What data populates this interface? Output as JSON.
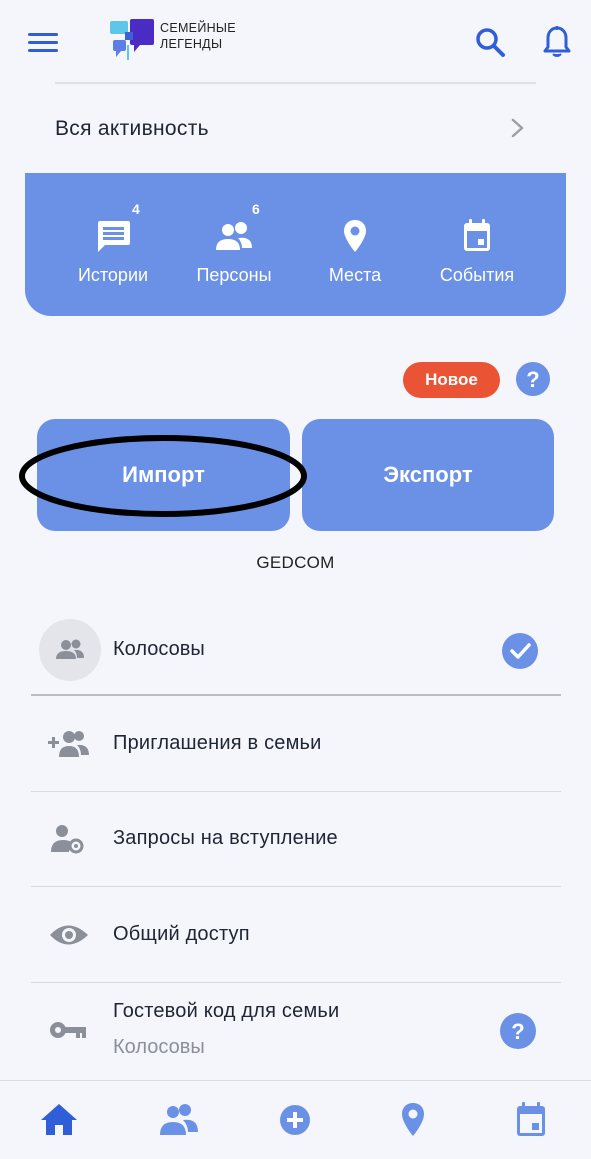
{
  "header": {
    "logo_text_line1": "СЕМЕЙНЫЕ",
    "logo_text_line2": "ЛЕГЕНДЫ",
    "menu_icon": "hamburger-icon",
    "search_icon": "search-icon",
    "notifications_icon": "bell-icon"
  },
  "activity": {
    "label": "Вся активность"
  },
  "stats": [
    {
      "label": "Истории",
      "count": "4",
      "icon": "message-icon"
    },
    {
      "label": "Персоны",
      "count": "6",
      "icon": "people-icon"
    },
    {
      "label": "Места",
      "count": "",
      "icon": "map-pin-icon"
    },
    {
      "label": "События",
      "count": "",
      "icon": "calendar-icon"
    }
  ],
  "badge": {
    "new_label": "Новое"
  },
  "gedcom": {
    "import_label": "Импорт",
    "export_label": "Экспорт",
    "caption": "GEDCOM"
  },
  "family": {
    "name": "Колосовы",
    "selected": true
  },
  "menu": [
    {
      "label": "Приглашения в семьи",
      "icon": "add-group-icon"
    },
    {
      "label": "Запросы на вступление",
      "icon": "user-gear-icon"
    },
    {
      "label": "Общий доступ",
      "icon": "eye-icon"
    },
    {
      "label": "Гостевой код для семьи",
      "sublabel": "Колосовы",
      "icon": "key-icon"
    }
  ],
  "bottom_nav": [
    {
      "name": "home",
      "icon": "home-icon",
      "active": true
    },
    {
      "name": "people",
      "icon": "people-icon"
    },
    {
      "name": "add",
      "icon": "plus-circle-icon"
    },
    {
      "name": "places",
      "icon": "map-pin-icon"
    },
    {
      "name": "events",
      "icon": "calendar-icon"
    }
  ],
  "colors": {
    "accent": "#2f5ed8",
    "card_blue": "#6a91e6",
    "badge_red": "#ea5434",
    "background": "#f4f6fb",
    "icon_gray": "#8a8f99"
  }
}
